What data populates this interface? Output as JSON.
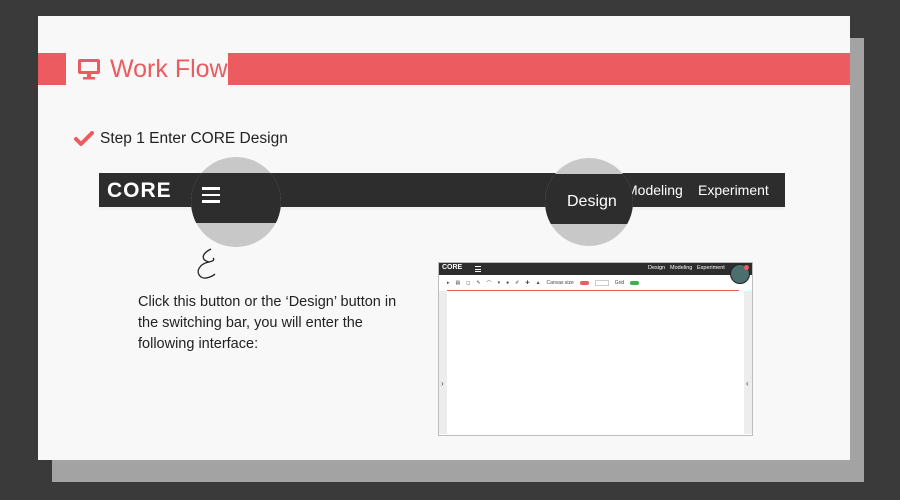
{
  "slide": {
    "title": "Work Flow",
    "accent_color": "#ec5b5f",
    "icon": "monitor-icon"
  },
  "step": {
    "check_icon": "check-icon",
    "text": "Step 1 Enter CORE Design"
  },
  "nav_bar": {
    "logo": "CORE",
    "menu_icon": "hamburger-icon",
    "items": [
      {
        "label": "Modeling"
      },
      {
        "label": "Experiment"
      }
    ],
    "magnified_design_label": "Design"
  },
  "description": "Click this button or the ‘Design’ button in the switching bar, you will enter the following interface:",
  "screenshot": {
    "logo": "CORE",
    "nav": [
      "Design",
      "Modeling",
      "Experiment"
    ],
    "toolbar": {
      "label1": "Canvas size",
      "label2": "Grid"
    },
    "left_arrow": "›",
    "right_arrow": "‹"
  }
}
